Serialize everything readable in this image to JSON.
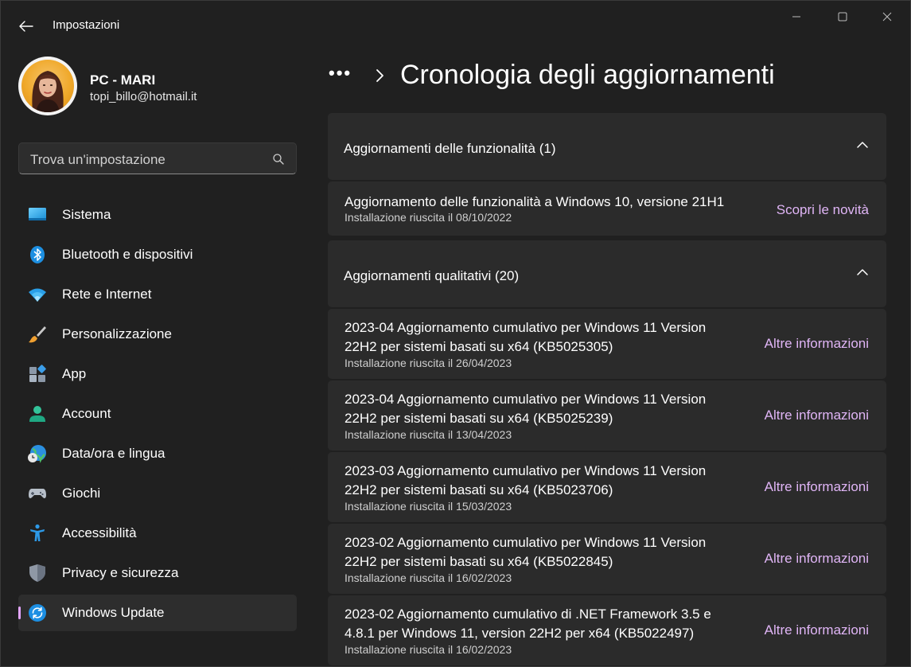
{
  "window": {
    "title": "Impostazioni"
  },
  "profile": {
    "name": "PC - MARI",
    "email": "topi_billo@hotmail.it"
  },
  "search": {
    "placeholder": "Trova un'impostazione"
  },
  "nav": {
    "items": [
      {
        "label": "Sistema",
        "icon": "monitor-icon"
      },
      {
        "label": "Bluetooth e dispositivi",
        "icon": "bluetooth-icon"
      },
      {
        "label": "Rete e Internet",
        "icon": "wifi-icon"
      },
      {
        "label": "Personalizzazione",
        "icon": "brush-icon"
      },
      {
        "label": "App",
        "icon": "apps-icon"
      },
      {
        "label": "Account",
        "icon": "person-icon"
      },
      {
        "label": "Data/ora e lingua",
        "icon": "globe-clock-icon"
      },
      {
        "label": "Giochi",
        "icon": "gamepad-icon"
      },
      {
        "label": "Accessibilità",
        "icon": "accessibility-icon"
      },
      {
        "label": "Privacy e sicurezza",
        "icon": "shield-icon"
      },
      {
        "label": "Windows Update",
        "icon": "update-icon",
        "active": true
      }
    ]
  },
  "breadcrumb": {
    "dots": "•••",
    "title": "Cronologia degli aggiornamenti"
  },
  "feature_section": {
    "label": "Aggiornamenti delle funzionalità (1)",
    "items": [
      {
        "title": "Aggiornamento delle funzionalità a Windows 10, versione 21H1",
        "status": "Installazione riuscita il 08/10/2022",
        "link": "Scopri le novità"
      }
    ]
  },
  "quality_section": {
    "label": "Aggiornamenti qualitativi (20)",
    "items": [
      {
        "title_line1": "2023-04 Aggiornamento cumulativo per Windows 11 Version",
        "title_line2": "22H2 per sistemi basati su x64 (KB5025305)",
        "status": "Installazione riuscita il 26/04/2023",
        "link": "Altre informazioni"
      },
      {
        "title_line1": "2023-04 Aggiornamento cumulativo per Windows 11 Version",
        "title_line2": "22H2 per sistemi basati su x64 (KB5025239)",
        "status": "Installazione riuscita il 13/04/2023",
        "link": "Altre informazioni"
      },
      {
        "title_line1": "2023-03 Aggiornamento cumulativo per Windows 11 Version",
        "title_line2": "22H2 per sistemi basati su x64 (KB5023706)",
        "status": "Installazione riuscita il 15/03/2023",
        "link": "Altre informazioni"
      },
      {
        "title_line1": "2023-02 Aggiornamento cumulativo per Windows 11 Version",
        "title_line2": "22H2 per sistemi basati su x64 (KB5022845)",
        "status": "Installazione riuscita il 16/02/2023",
        "link": "Altre informazioni"
      },
      {
        "title_line1": "2023-02 Aggiornamento cumulativo di .NET Framework 3.5 e",
        "title_line2": "4.8.1 per Windows 11, version 22H2 per x64 (KB5022497)",
        "status": "Installazione riuscita il 16/02/2023",
        "link": "Altre informazioni"
      }
    ]
  },
  "colors": {
    "accent": "#e0b5f6",
    "card": "#2b2b2b",
    "background": "#202020"
  }
}
